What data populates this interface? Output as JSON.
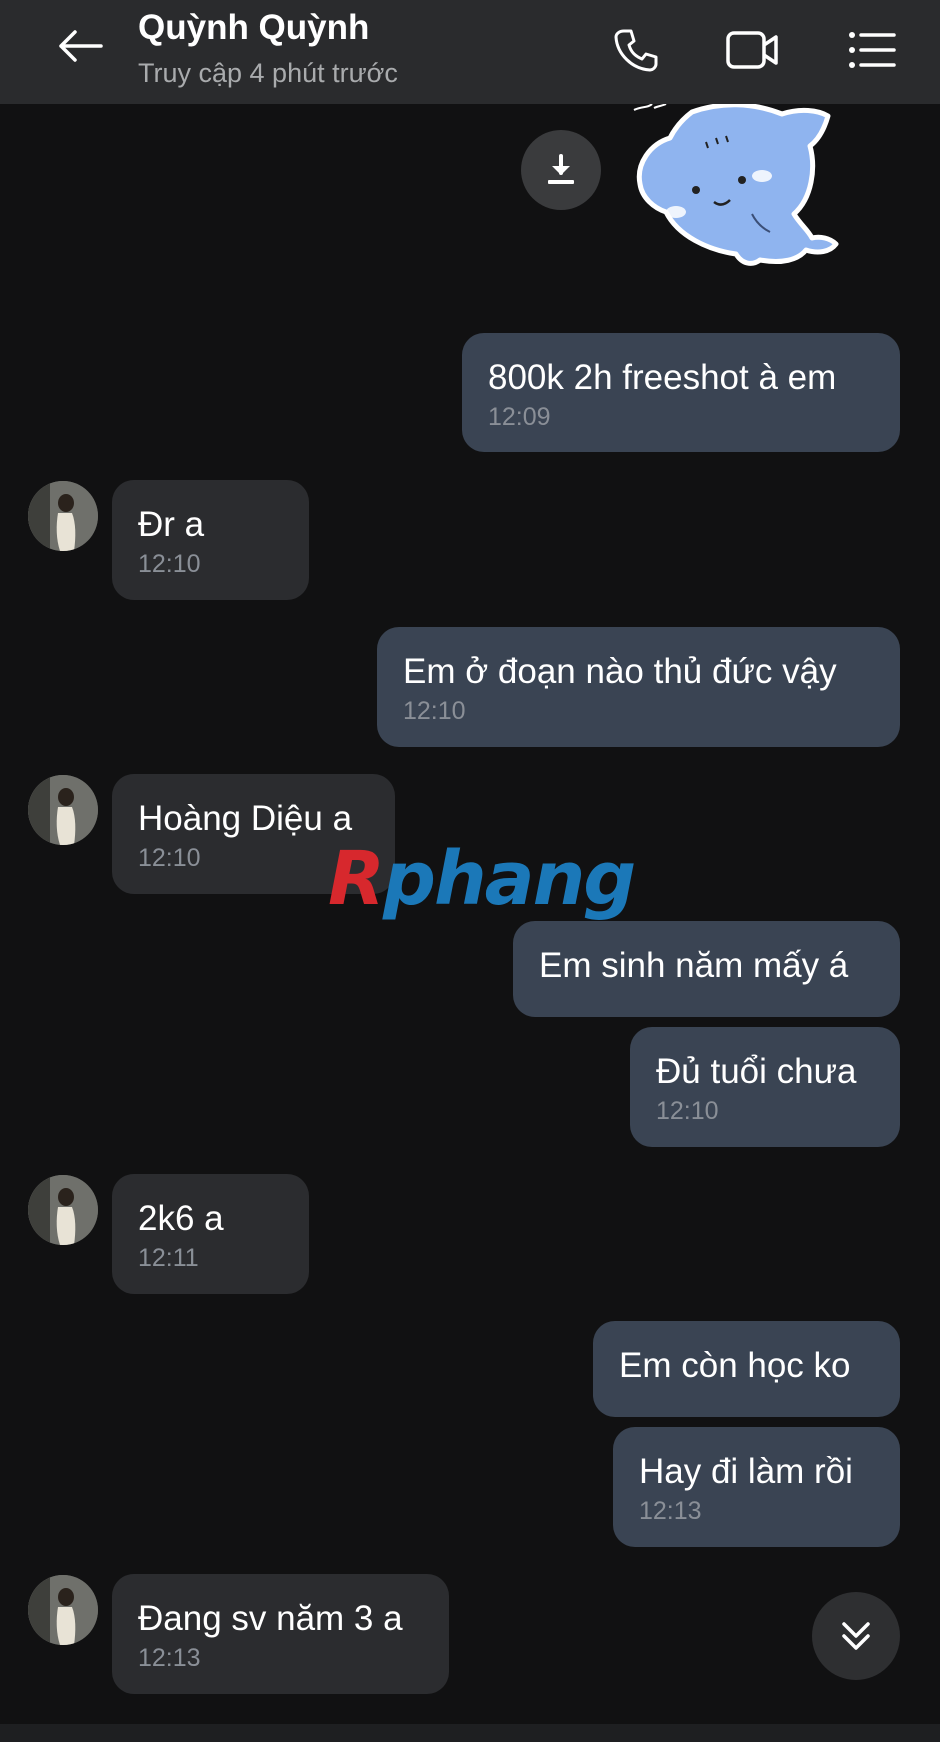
{
  "header": {
    "title": "Quỳnh Quỳnh",
    "status": "Truy cập 4 phút trước",
    "icons": {
      "back": "back-arrow-icon",
      "call": "phone-icon",
      "video": "video-camera-icon",
      "menu": "menu-list-icon"
    }
  },
  "messages": [
    {
      "direction": "out",
      "text": "800k 2h freeshot à em",
      "time": "12:09"
    },
    {
      "direction": "in",
      "text": "Đr a",
      "time": "12:10"
    },
    {
      "direction": "out",
      "text": "Em ở đoạn nào thủ đức vậy",
      "time": "12:10"
    },
    {
      "direction": "in",
      "text": "Hoàng Diệu a",
      "time": "12:10"
    },
    {
      "direction": "out",
      "text": "Em sinh năm mấy á",
      "time": ""
    },
    {
      "direction": "out",
      "text": "Đủ tuổi chưa",
      "time": "12:10"
    },
    {
      "direction": "in",
      "text": "2k6 a",
      "time": "12:11"
    },
    {
      "direction": "out",
      "text": "Em còn học ko",
      "time": ""
    },
    {
      "direction": "out",
      "text": "Hay đi làm rồi",
      "time": "12:13"
    },
    {
      "direction": "in",
      "text": "Đang sv năm 3 a",
      "time": "12:13"
    }
  ],
  "watermark": {
    "part1": "R",
    "part2": "phang"
  },
  "colors": {
    "header_bg": "#2a2b2d",
    "background": "#111112",
    "outgoing_bubble": "#3a4453",
    "incoming_bubble": "#2b2c2f",
    "time_text": "#8a8f97"
  }
}
